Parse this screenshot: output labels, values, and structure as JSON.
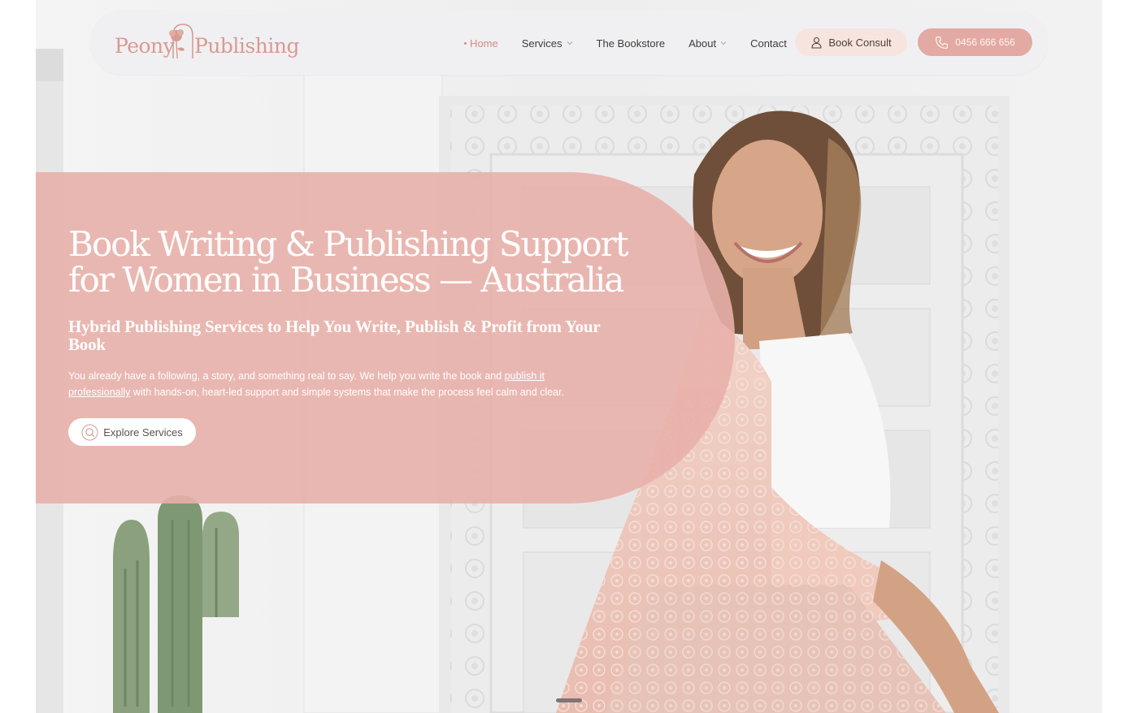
{
  "brand": {
    "name_first": "Peony",
    "name_second": "Publishing",
    "logo_color": "#d99a92"
  },
  "nav": {
    "items": [
      {
        "label": "Home",
        "active": true,
        "dropdown": false
      },
      {
        "label": "Services",
        "active": false,
        "dropdown": true
      },
      {
        "label": "The Bookstore",
        "active": false,
        "dropdown": false
      },
      {
        "label": "About",
        "active": false,
        "dropdown": true
      },
      {
        "label": "Contact",
        "active": false,
        "dropdown": false
      }
    ],
    "consult_label": "Book Consult",
    "consult_icon": "user-icon",
    "phone_label": "0456 666 656",
    "phone_icon": "phone-icon"
  },
  "hero": {
    "headline_line1": "Book Writing & Publishing Support",
    "headline_line2": "for Women in Business — Australia",
    "subheading": "Hybrid Publishing Services to Help You Write, Publish & Profit from Your Book",
    "description_before_link": "You already have a following, a story, and something real to say. We help you write the book and ",
    "description_link": "publish it professionally",
    "description_after_link": " with hands-on, heart-led support and simple systems that make the process feel calm and clear.",
    "cta_label": "Explore Services",
    "cta_icon": "search-icon"
  },
  "colors": {
    "panel": "#e8b0aa",
    "accent": "#e2aaa2",
    "consult_bg": "#f8e4df",
    "text_dark": "#3f3a3a"
  }
}
